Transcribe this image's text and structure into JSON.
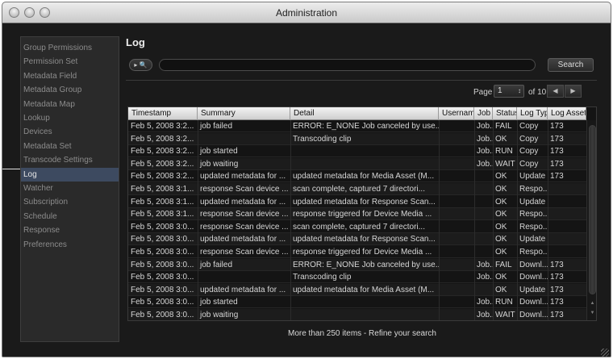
{
  "window": {
    "title": "Administration"
  },
  "sidebar": {
    "items": [
      {
        "label": "Group Permissions",
        "selected": false
      },
      {
        "label": "Permission Set",
        "selected": false
      },
      {
        "label": "Metadata Field",
        "selected": false
      },
      {
        "label": "Metadata Group",
        "selected": false
      },
      {
        "label": "Metadata Map",
        "selected": false
      },
      {
        "label": "Lookup",
        "selected": false
      },
      {
        "label": "Devices",
        "selected": false
      },
      {
        "label": "Metadata Set",
        "selected": false
      },
      {
        "label": "Transcode Settings",
        "selected": false
      },
      {
        "label": "Log",
        "selected": true
      },
      {
        "label": "Watcher",
        "selected": false
      },
      {
        "label": "Subscription",
        "selected": false
      },
      {
        "label": "Schedule",
        "selected": false
      },
      {
        "label": "Response",
        "selected": false
      },
      {
        "label": "Preferences",
        "selected": false
      }
    ]
  },
  "main": {
    "title": "Log",
    "search": {
      "scope_label": "▸ 🔍",
      "value": "",
      "placeholder": "",
      "button_label": "Search"
    },
    "pager": {
      "page_label": "Page",
      "current_page": "1",
      "of_label": "of 10",
      "prev_icon": "left-arrow-icon",
      "next_icon": "right-arrow-icon"
    },
    "table": {
      "columns": [
        "Timestamp",
        "Summary",
        "Detail",
        "Usernam",
        "Job",
        "Status",
        "Log Type",
        "Log Asset"
      ],
      "rows": [
        [
          "Feb 5, 2008 3:2...",
          "job failed",
          "ERROR: E_NONE  Job canceled by use...",
          "",
          "Job...",
          "FAIL",
          "Copy",
          "173"
        ],
        [
          "Feb 5, 2008 3:2...",
          "",
          "Transcoding clip",
          "",
          "Job...",
          "OK",
          "Copy",
          "173"
        ],
        [
          "Feb 5, 2008 3:2...",
          "job started",
          "",
          "",
          "Job...",
          "RUN",
          "Copy",
          "173"
        ],
        [
          "Feb 5, 2008 3:2...",
          "job waiting",
          "",
          "",
          "Job...",
          "WAIT",
          "Copy",
          "173"
        ],
        [
          "Feb 5, 2008 3:2...",
          "updated metadata for ...",
          "updated metadata for Media Asset (M...",
          "",
          "",
          "OK",
          "Update",
          "173"
        ],
        [
          "Feb 5, 2008 3:1...",
          "response Scan device ...",
          "scan complete,  captured 7 directori...",
          "",
          "",
          "OK",
          "Respo...",
          ""
        ],
        [
          "Feb 5, 2008 3:1...",
          "updated metadata for ...",
          "updated metadata for Response Scan...",
          "",
          "",
          "OK",
          "Update",
          ""
        ],
        [
          "Feb 5, 2008 3:1...",
          "response Scan device ...",
          "response triggered for Device Media ...",
          "",
          "",
          "OK",
          "Respo...",
          ""
        ],
        [
          "Feb 5, 2008 3:0...",
          "response Scan device ...",
          "scan complete,  captured 7 directori...",
          "",
          "",
          "OK",
          "Respo...",
          ""
        ],
        [
          "Feb 5, 2008 3:0...",
          "updated metadata for ...",
          "updated metadata for Response Scan...",
          "",
          "",
          "OK",
          "Update",
          ""
        ],
        [
          "Feb 5, 2008 3:0...",
          "response Scan device ...",
          "response triggered for Device Media ...",
          "",
          "",
          "OK",
          "Respo...",
          ""
        ],
        [
          "Feb 5, 2008 3:0...",
          "job failed",
          "ERROR: E_NONE  Job canceled by use...",
          "",
          "Job...",
          "FAIL",
          "Downl...",
          "173"
        ],
        [
          "Feb 5, 2008 3:0...",
          "",
          "Transcoding clip",
          "",
          "Job...",
          "OK",
          "Downl...",
          "173"
        ],
        [
          "Feb 5, 2008 3:0...",
          "updated metadata for ...",
          "updated metadata for Media Asset (M...",
          "",
          "",
          "OK",
          "Update",
          "173"
        ],
        [
          "Feb 5, 2008 3:0...",
          "job started",
          "",
          "",
          "Job...",
          "RUN",
          "Downl...",
          "173"
        ],
        [
          "Feb 5, 2008 3:0...",
          "job waiting",
          "",
          "",
          "Job...",
          "WAIT",
          "Downl...",
          "173"
        ]
      ]
    },
    "footer_note": "More than 250 items - Refine your search"
  },
  "colors": {
    "selected_row": "#3d4a60",
    "background": "#1a1a1a",
    "header": "#e0e0e0"
  }
}
